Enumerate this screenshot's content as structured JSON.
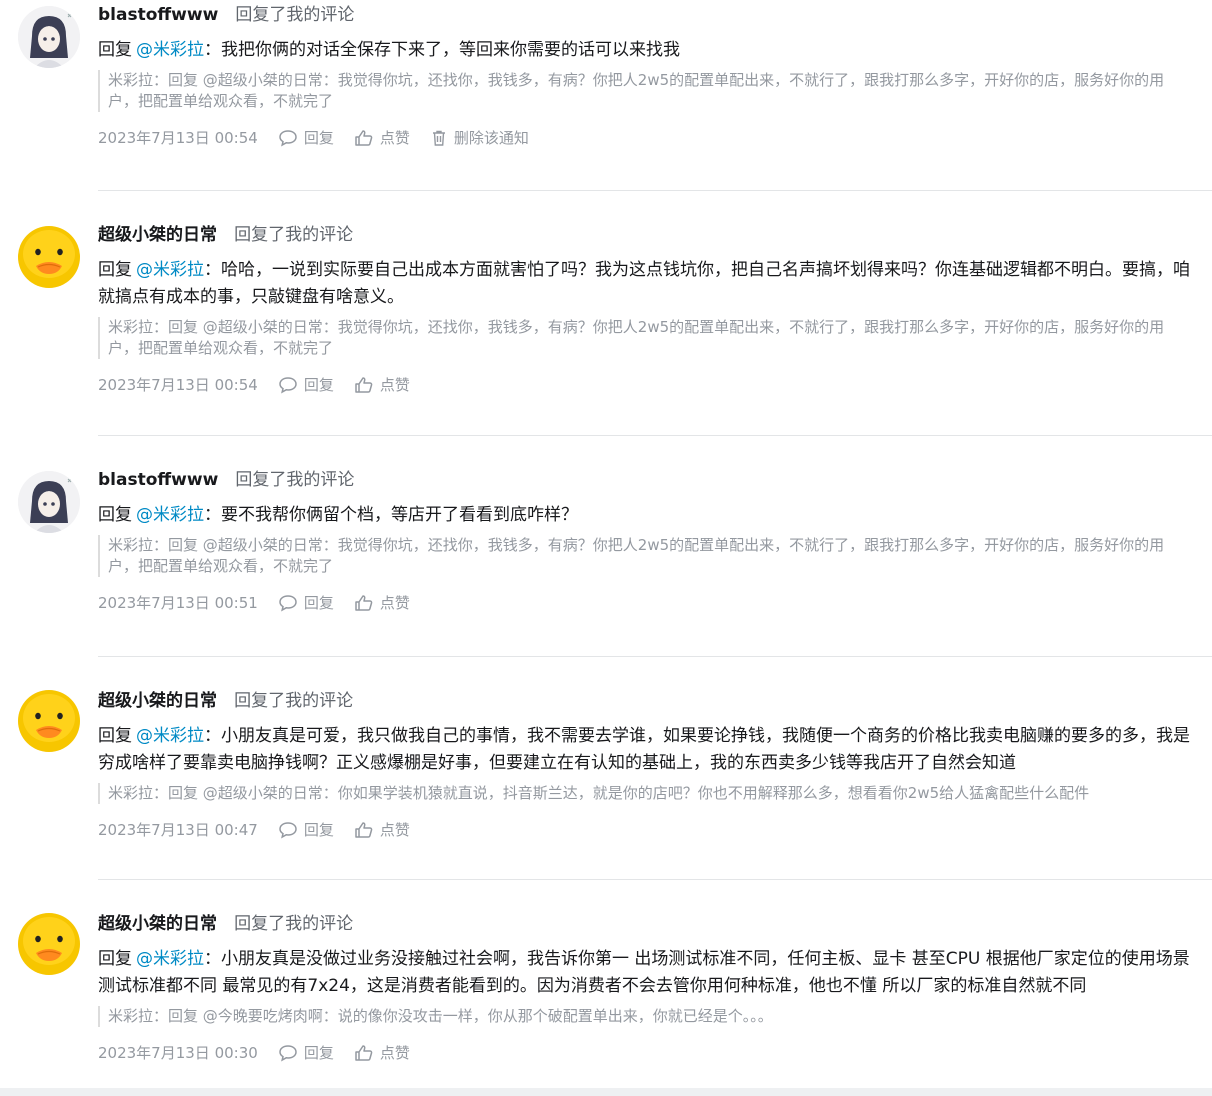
{
  "notifications": [
    {
      "user": "blastoffwww",
      "avatar": "anime-girl-avatar",
      "action": "回复了我的评论",
      "reply_prefix": "回复",
      "mention": "@米彩拉",
      "text": "：我把你俩的对话全保存下来了，等回来你需要的话可以来找我",
      "quote": "米彩拉：回复 @超级小桀的日常：我觉得你坑，还找你，我钱多，有病？你把人2w5的配置单配出来，不就行了，跟我打那么多字，开好你的店，服务好你的用户，把配置单给观众看，不就完了",
      "time": "2023年7月13日 00:54",
      "reply_label": "回复",
      "like_label": "点赞",
      "delete_label": "删除该通知"
    },
    {
      "user": "超级小桀的日常",
      "avatar": "yellow-duck-avatar",
      "action": "回复了我的评论",
      "reply_prefix": "回复",
      "mention": "@米彩拉",
      "text": "：哈哈，一说到实际要自己出成本方面就害怕了吗？我为这点钱坑你，把自己名声搞坏划得来吗？你连基础逻辑都不明白。要搞，咱就搞点有成本的事，只敲键盘有啥意义。",
      "quote": "米彩拉：回复 @超级小桀的日常：我觉得你坑，还找你，我钱多，有病？你把人2w5的配置单配出来，不就行了，跟我打那么多字，开好你的店，服务好你的用户，把配置单给观众看，不就完了",
      "time": "2023年7月13日 00:54",
      "reply_label": "回复",
      "like_label": "点赞"
    },
    {
      "user": "blastoffwww",
      "avatar": "anime-girl-avatar",
      "action": "回复了我的评论",
      "reply_prefix": "回复",
      "mention": "@米彩拉",
      "text": "：要不我帮你俩留个档，等店开了看看到底咋样？",
      "quote": "米彩拉：回复 @超级小桀的日常：我觉得你坑，还找你，我钱多，有病？你把人2w5的配置单配出来，不就行了，跟我打那么多字，开好你的店，服务好你的用户，把配置单给观众看，不就完了",
      "time": "2023年7月13日 00:51",
      "reply_label": "回复",
      "like_label": "点赞"
    },
    {
      "user": "超级小桀的日常",
      "avatar": "yellow-duck-avatar",
      "action": "回复了我的评论",
      "reply_prefix": "回复",
      "mention": "@米彩拉",
      "text": "：小朋友真是可爱，我只做我自己的事情，我不需要去学谁，如果要论挣钱，我随便一个商务的价格比我卖电脑赚的要多的多，我是穷成啥样了要靠卖电脑挣钱啊？正义感爆棚是好事，但要建立在有认知的基础上，我的东西卖多少钱等我店开了自然会知道",
      "quote": "米彩拉：回复 @超级小桀的日常：你如果学装机猿就直说，抖音斯兰达，就是你的店吧？你也不用解释那么多，想看看你2w5给人猛禽配些什么配件",
      "time": "2023年7月13日 00:47",
      "reply_label": "回复",
      "like_label": "点赞"
    },
    {
      "user": "超级小桀的日常",
      "avatar": "yellow-duck-avatar",
      "action": "回复了我的评论",
      "reply_prefix": "回复",
      "mention": "@米彩拉",
      "text": "：小朋友真是没做过业务没接触过社会啊，我告诉你第一 出场测试标准不同，任何主板、显卡 甚至CPU 根据他厂家定位的使用场景 测试标准都不同 最常见的有7x24，这是消费者能看到的。因为消费者不会去管你用何种标准，他也不懂 所以厂家的标准自然就不同",
      "quote": "米彩拉：回复 @今晚要吃烤肉啊：说的像你没攻击一样，你从那个破配置单出来，你就已经是个。。。",
      "time": "2023年7月13日 00:30",
      "reply_label": "回复",
      "like_label": "点赞"
    }
  ],
  "colors": {
    "mention": "#008ac5",
    "muted": "#9499a0",
    "text": "#18191c",
    "divider": "#e3e5e7"
  }
}
